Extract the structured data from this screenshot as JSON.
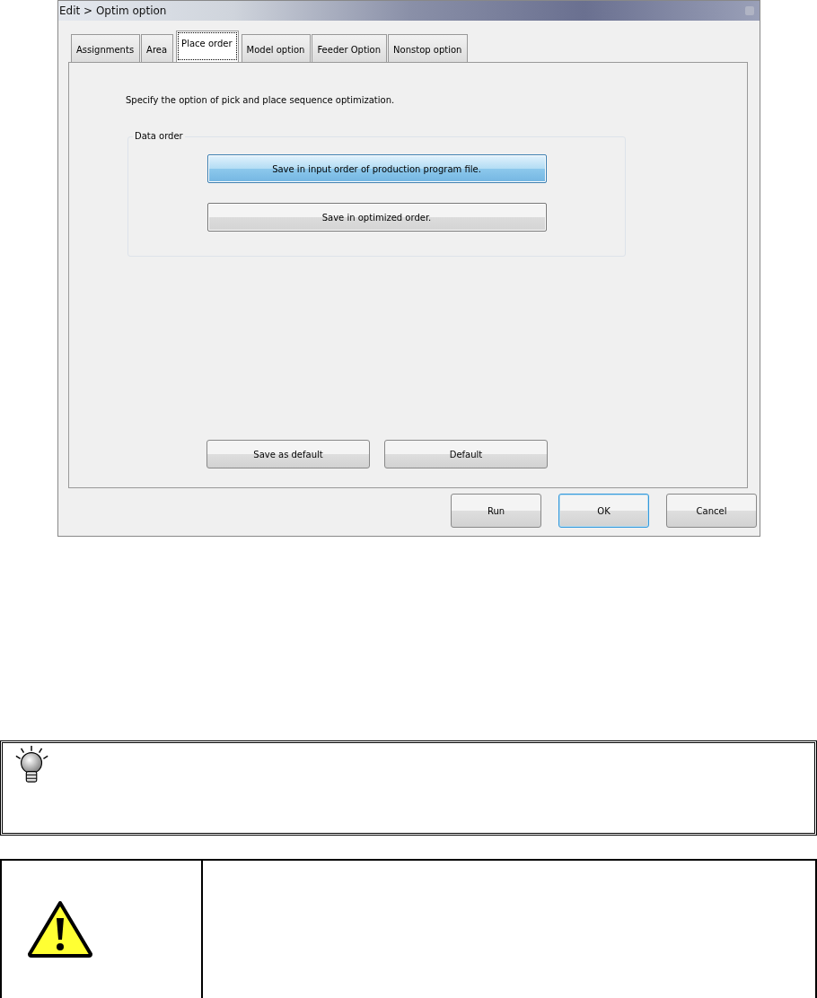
{
  "window": {
    "title": "Edit > Optim option"
  },
  "tabs": [
    {
      "label": "Assignments",
      "selected": false
    },
    {
      "label": "Area",
      "selected": false
    },
    {
      "label": "Place order",
      "selected": true
    },
    {
      "label": "Model option",
      "selected": false
    },
    {
      "label": "Feeder Option",
      "selected": false
    },
    {
      "label": "Nonstop option",
      "selected": false
    }
  ],
  "instruction": "Specify the option of pick and place sequence optimization.",
  "data_order": {
    "legend": "Data order",
    "options": [
      {
        "label": "Save in input order of production program file.",
        "selected": true
      },
      {
        "label": "Save in optimized order.",
        "selected": false
      }
    ]
  },
  "panel_buttons": [
    "Save as default",
    "Default"
  ],
  "dialog_buttons": [
    {
      "label": "Run",
      "default": false
    },
    {
      "label": "OK",
      "default": true
    },
    {
      "label": "Cancel",
      "default": false
    }
  ]
}
